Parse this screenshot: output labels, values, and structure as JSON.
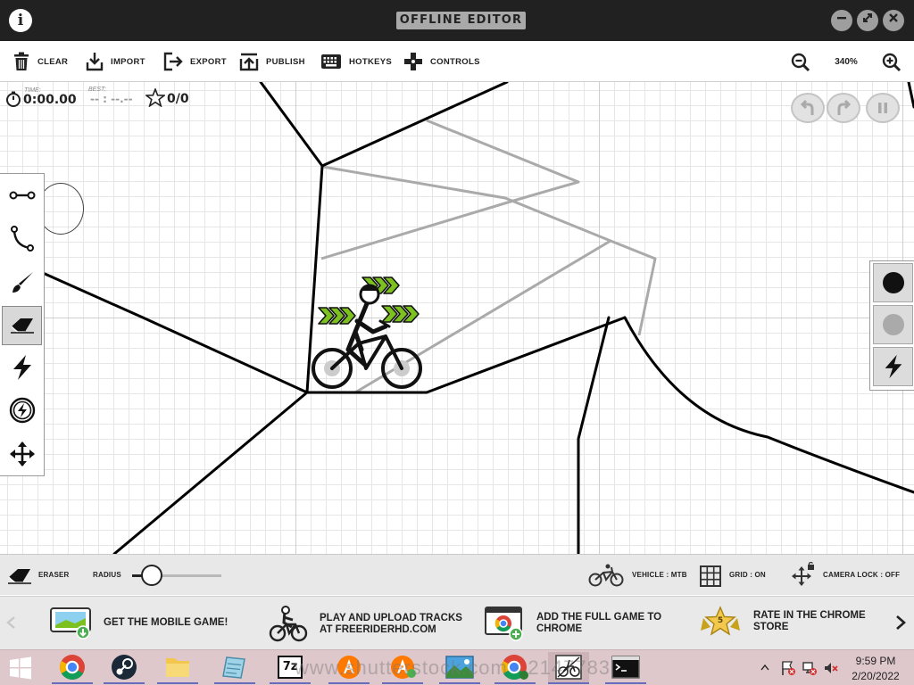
{
  "window": {
    "title": "OFFLINE EDITOR",
    "info_icon": "i"
  },
  "toolbar": {
    "clear_label": "CLEAR",
    "import_label": "IMPORT",
    "export_label": "EXPORT",
    "publish_label": "PUBLISH",
    "hotkeys_label": "HOTKEYS",
    "controls_label": "CONTROLS",
    "zoom_level": "340%"
  },
  "hud": {
    "time_label": "TIME:",
    "time_value": "0:00.00",
    "best_label": "BEST:",
    "best_value": "-- : --.--",
    "stars_value": "0/0"
  },
  "tools": [
    "straight-line",
    "curve",
    "brush",
    "eraser",
    "powerup",
    "special-powerup",
    "camera-move"
  ],
  "active_tool": "eraser",
  "line_colors": {
    "physics": "#000000",
    "scenery": "#aaaaaa",
    "accent": "#7cc11f"
  },
  "statusbar": {
    "tool_label": "ERASER",
    "radius_label": "RADIUS",
    "radius_fraction": 0.22,
    "vehicle_label": "VEHICLE : MTB",
    "grid_label": "GRID : ON",
    "camera_lock_label": "CAMERA LOCK : OFF"
  },
  "promos": [
    {
      "text": "GET THE MOBILE GAME!"
    },
    {
      "text": "PLAY AND UPLOAD TRACKS\nAT FREERIDERHD.COM"
    },
    {
      "text": "ADD THE FULL GAME TO\nCHROME"
    },
    {
      "text": "RATE IN THE CHROME\nSTORE",
      "badge": "5"
    }
  ],
  "taskbar": {
    "time": "9:59 PM",
    "date": "2/20/2022",
    "sevenzip_label": "7z",
    "watermark": "www.shutterstock.com · 2147783"
  }
}
